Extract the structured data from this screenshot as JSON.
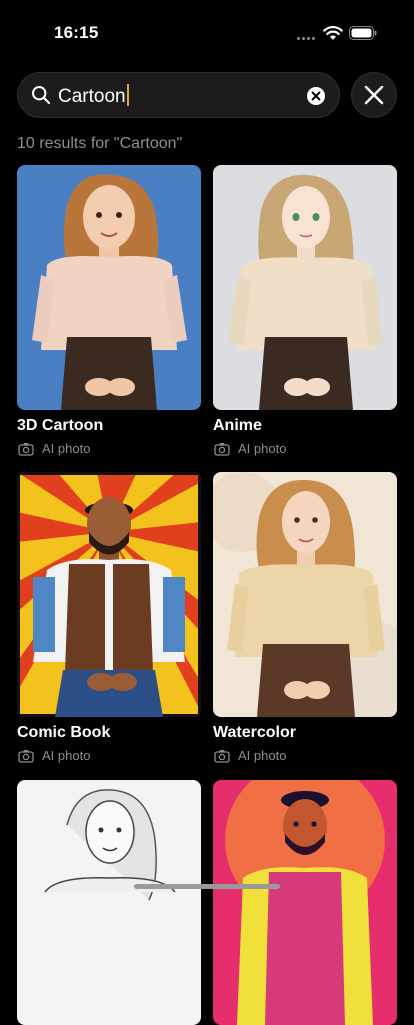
{
  "status_bar": {
    "time": "16:15"
  },
  "search": {
    "query": "Cartoon",
    "placeholder": "Search"
  },
  "results": {
    "summary": "10 results for \"Cartoon\""
  },
  "items": [
    {
      "title": "3D Cartoon",
      "meta": "AI photo",
      "icon": "camera-icon"
    },
    {
      "title": "Anime",
      "meta": "AI photo",
      "icon": "camera-icon"
    },
    {
      "title": "Comic Book",
      "meta": "AI photo",
      "icon": "camera-icon"
    },
    {
      "title": "Watercolor",
      "meta": "AI photo",
      "icon": "camera-icon"
    },
    {
      "title": "",
      "meta": "",
      "icon": ""
    },
    {
      "title": "",
      "meta": "",
      "icon": ""
    }
  ],
  "colors": {
    "background": "#000000",
    "surface": "#1c1c1e",
    "secondary_text": "#8e8e93",
    "caret": "#e6a23c"
  }
}
